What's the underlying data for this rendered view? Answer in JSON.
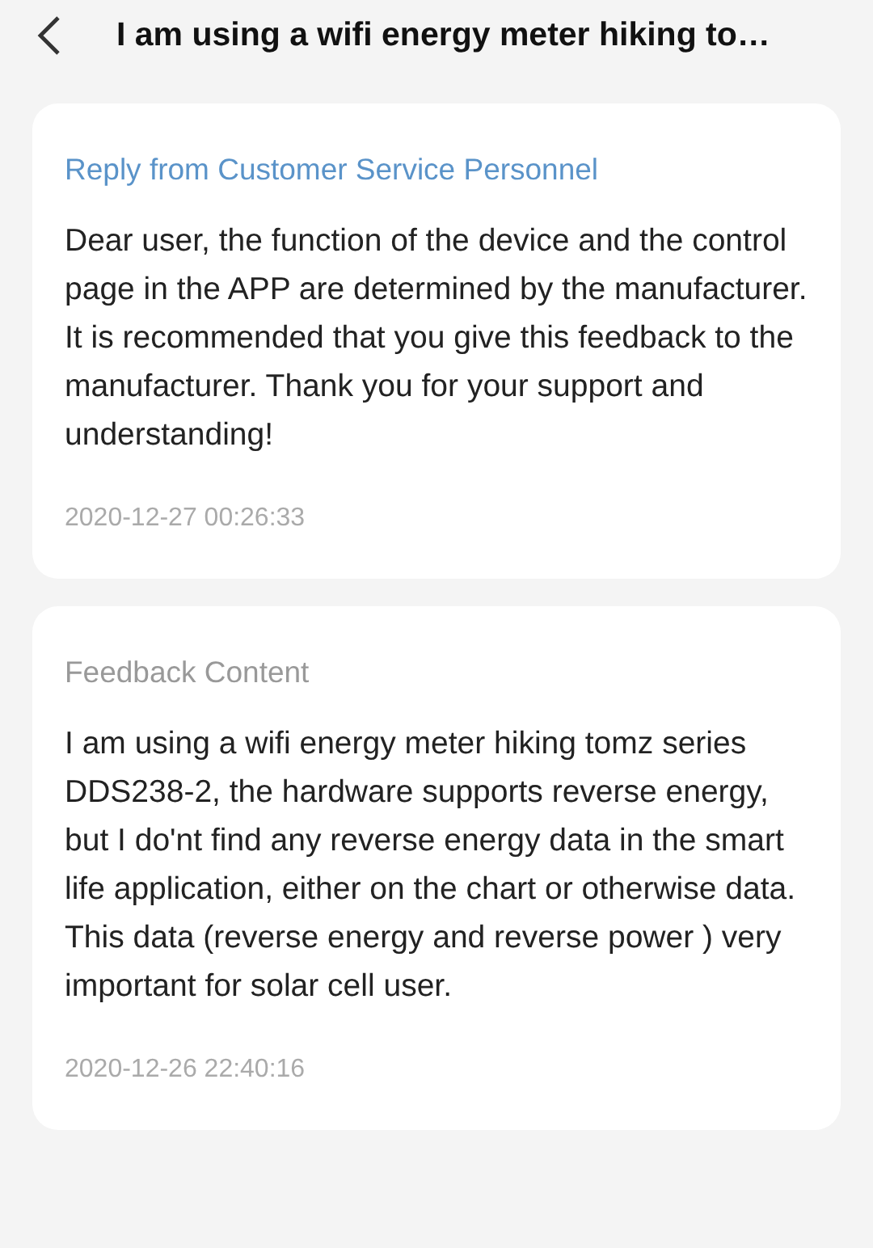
{
  "header": {
    "title": "I am using a wifi energy meter hiking to…"
  },
  "cards": [
    {
      "kind": "reply",
      "label": "Reply from Customer Service Personnel",
      "body": "Dear user, the function of the device and the control page in the APP are determined by the manufacturer. It is recommended that you give this feedback to the manufacturer. Thank you for your support and understanding!",
      "time": "2020-12-27 00:26:33"
    },
    {
      "kind": "feedback",
      "label": "Feedback Content",
      "body": "I am using a wifi energy meter hiking tomz series DDS238-2, the hardware supports reverse energy, but I do'nt find any reverse energy data in the smart life application, either on the chart or otherwise data. This data (reverse energy and reverse power ) very important for solar cell user.",
      "time": "2020-12-26 22:40:16"
    }
  ]
}
